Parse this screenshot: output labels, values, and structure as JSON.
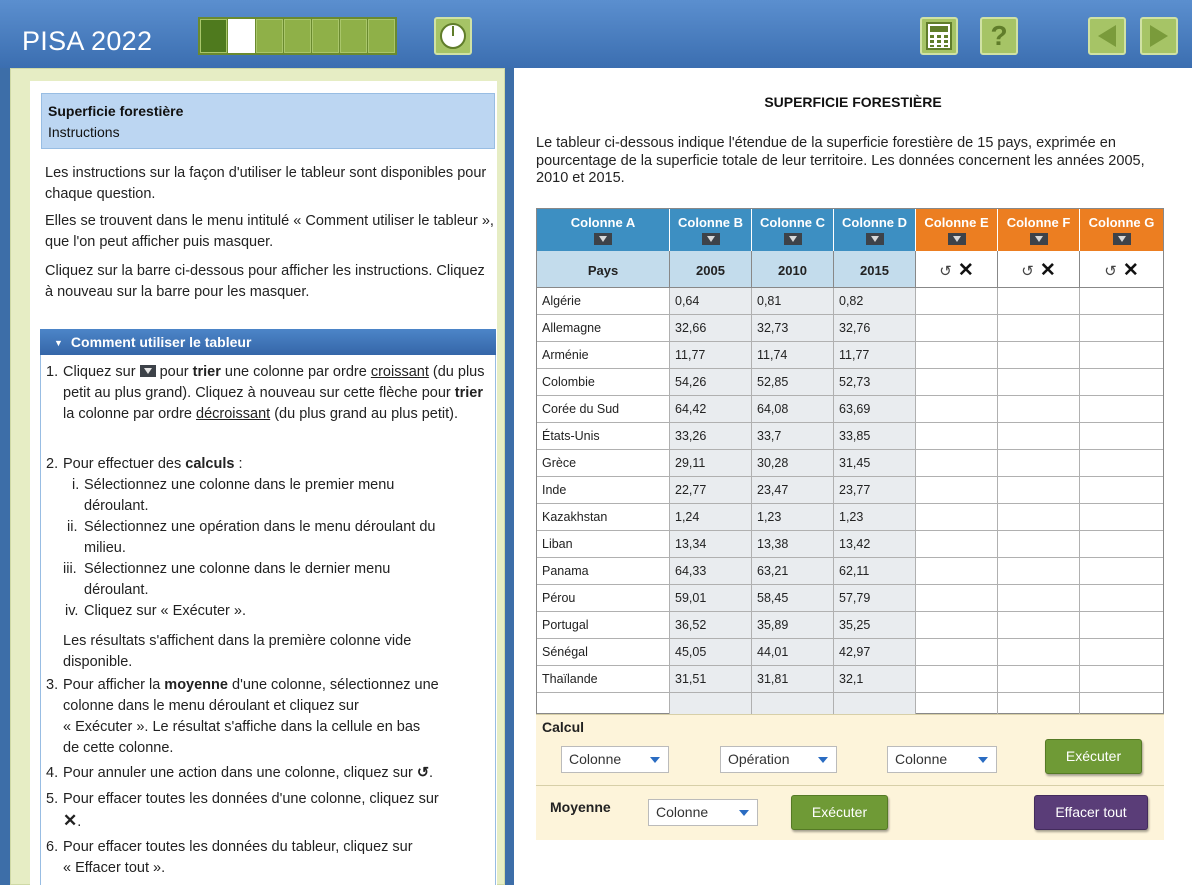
{
  "header": {
    "title": "PISA 2022",
    "progress": {
      "total_segments": 7,
      "done_segments": 1,
      "current_segment": 2
    }
  },
  "left": {
    "unit_title": "Superficie forestière",
    "unit_subtitle": "Instructions",
    "para1": "Les instructions sur la façon d'utiliser le tableur sont disponibles pour chaque question.",
    "para2": "Elles se trouvent dans le menu intitulé « Comment utiliser le tableur », que l'on peut afficher puis masquer.",
    "para3": "Cliquez sur la barre ci-dessous pour afficher les instructions. Cliquez à nouveau sur la barre pour les masquer.",
    "howto_title": "Comment utiliser le tableur",
    "howto": {
      "s1_num": "1.",
      "s1_a": "Cliquez sur",
      "s1_b": "pour",
      "s1_c": "trier",
      "s1_d": "une colonne par ordre",
      "s1_e": "croissant",
      "s1_f": "(du plus petit au plus grand). Cliquez à nouveau sur cette",
      "s1_g": "flèche pour",
      "s1_h": "trier",
      "s1_i": "la colonne par ordre",
      "s1_j": "décroissant",
      "s1_k": "(du plus",
      "s1_l": "grand au plus petit).",
      "s2_num": "2.",
      "s2_a": "Pour effectuer des",
      "s2_b": "calculs",
      "s2_c": ":",
      "s2_i_num": "i.",
      "s2_i_a": "Sélectionnez une colonne dans le premier menu",
      "s2_i_b": "déroulant.",
      "s2_ii_num": "ii.",
      "s2_ii_a": "Sélectionnez une opération dans le menu déroulant du",
      "s2_ii_b": "milieu.",
      "s2_iii_num": "iii.",
      "s2_iii_a": "Sélectionnez une colonne dans le dernier menu",
      "s2_iii_b": "déroulant.",
      "s2_iv_num": "iv.",
      "s2_iv_a": "Cliquez sur « Exécuter ».",
      "s2_res_a": "Les résultats s'affichent dans la première colonne vide",
      "s2_res_b": "disponible.",
      "s3_num": "3.",
      "s3_a": "Pour afficher la",
      "s3_b": "moyenne",
      "s3_c": "d'une colonne, sélectionnez une",
      "s3_d": "colonne dans le menu déroulant et cliquez sur",
      "s3_e": "« Exécuter ». Le résultat s'affiche dans la cellule en bas",
      "s3_f": "de cette colonne.",
      "s4_num": "4.",
      "s4_a": "Pour annuler une action dans une colonne, cliquez sur",
      "s5_num": "5.",
      "s5_a": "Pour effacer toutes les données d'une colonne, cliquez sur",
      "s6_num": "6.",
      "s6_a": "Pour effacer toutes les données du tableur, cliquez sur",
      "s6_b": "« Effacer tout »."
    }
  },
  "right": {
    "title": "SUPERFICIE FORESTIÈRE",
    "intro": "Le tableur ci-dessous indique l'étendue de la superficie forestière de 15 pays, exprimée en pourcentage de la superficie totale de leur territoire. Les données concernent les années 2005, 2010 et 2015.",
    "columns": [
      "Colonne A",
      "Colonne B",
      "Colonne C",
      "Colonne D",
      "Colonne E",
      "Colonne F",
      "Colonne G"
    ],
    "subheaders": [
      "Pays",
      "2005",
      "2010",
      "2015"
    ],
    "rows": [
      [
        "Algérie",
        "0,64",
        "0,81",
        "0,82"
      ],
      [
        "Allemagne",
        "32,66",
        "32,73",
        "32,76"
      ],
      [
        "Arménie",
        "11,77",
        "11,74",
        "11,77"
      ],
      [
        "Colombie",
        "54,26",
        "52,85",
        "52,73"
      ],
      [
        "Corée du Sud",
        "64,42",
        "64,08",
        "63,69"
      ],
      [
        "États-Unis",
        "33,26",
        "33,7",
        "33,85"
      ],
      [
        "Grèce",
        "29,11",
        "30,28",
        "31,45"
      ],
      [
        "Inde",
        "22,77",
        "23,47",
        "23,77"
      ],
      [
        "Kazakhstan",
        "1,24",
        "1,23",
        "1,23"
      ],
      [
        "Liban",
        "13,34",
        "13,38",
        "13,42"
      ],
      [
        "Panama",
        "64,33",
        "63,21",
        "62,11"
      ],
      [
        "Pérou",
        "59,01",
        "58,45",
        "57,79"
      ],
      [
        "Portugal",
        "36,52",
        "35,89",
        "35,25"
      ],
      [
        "Sénégal",
        "45,05",
        "44,01",
        "42,97"
      ],
      [
        "Thaïlande",
        "31,51",
        "31,81",
        "32,1"
      ]
    ],
    "calc": {
      "label": "Calcul",
      "select1": "Colonne",
      "select2": "Opération",
      "select3": "Colonne",
      "execute": "Exécuter"
    },
    "mean": {
      "label": "Moyenne",
      "select": "Colonne",
      "execute": "Exécuter",
      "clear_all": "Effacer tout"
    }
  },
  "colors": {
    "topbar": "#3b6eb0",
    "blue_header": "#3d8fc2",
    "orange_header": "#ec7e21",
    "green_button": "#6f9a36",
    "purple_button": "#5a3d78"
  }
}
